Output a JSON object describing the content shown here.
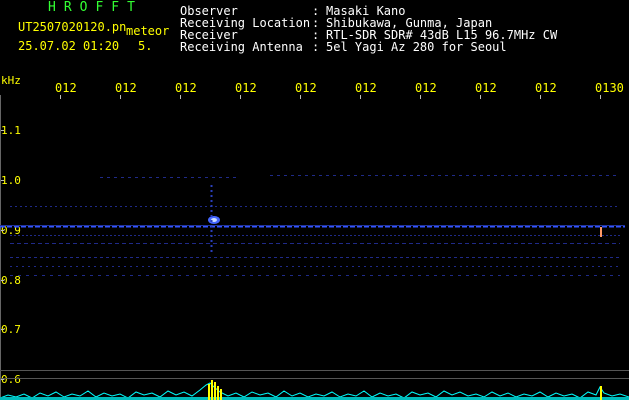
{
  "header": {
    "app_title": "HROFFT",
    "file_name": "UT2507020120.pn",
    "tag": "meteor",
    "date_time": "25.07.02 01:20",
    "interval": "5.",
    "info": [
      {
        "label": "Observer",
        "value": "Masaki Kano"
      },
      {
        "label": "Receiving Location",
        "value": "Shibukawa, Gunma, Japan"
      },
      {
        "label": "Receiver",
        "value": "RTL-SDR SDR# 43dB L15 96.7MHz CW"
      },
      {
        "label": "Receiving Antenna",
        "value": "5el Yagi Az 280 for Seoul"
      }
    ],
    "colon": ":"
  },
  "axis": {
    "unit": "kHz",
    "x_ticks": [
      "012",
      "012",
      "012",
      "012",
      "012",
      "012",
      "012",
      "012",
      "012",
      "0130"
    ],
    "y_ticks": [
      "1.1",
      "1.0",
      "0.9",
      "0.8",
      "0.7",
      "0.6"
    ]
  },
  "colors": {
    "background": "#000000",
    "axis_text": "#ffff00",
    "title": "#33ff33",
    "info_text": "#ffffff",
    "grid": "#555555",
    "signal": "#3355ff",
    "spectrum": "#00ffff",
    "burst": "#ffff00"
  }
}
